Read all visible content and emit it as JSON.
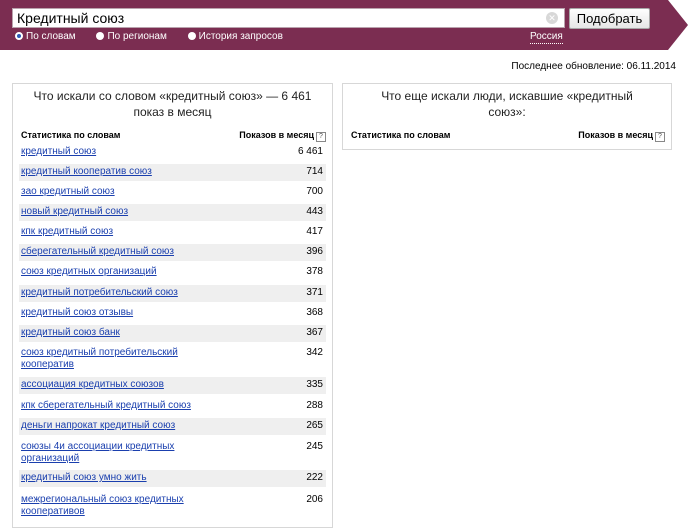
{
  "search": {
    "value": "Кредитный союз",
    "submit_label": "Подобрать"
  },
  "modes": [
    {
      "label": "По словам",
      "selected": true
    },
    {
      "label": "По регионам",
      "selected": false
    },
    {
      "label": "История запросов",
      "selected": false
    }
  ],
  "region": "Россия",
  "last_update": "Последнее обновление: 06.11.2014",
  "left_panel": {
    "title": "Что искали со словом «кредитный союз» — 6 461 показ в месяц",
    "col_words": "Статистика по словам",
    "col_count": "Показов в месяц",
    "rows": [
      {
        "phrase": "кредитный союз",
        "count": "6 461"
      },
      {
        "phrase": "кредитный кооператив союз",
        "count": "714"
      },
      {
        "phrase": "зао кредитный союз",
        "count": "700"
      },
      {
        "phrase": "новый кредитный союз",
        "count": "443"
      },
      {
        "phrase": "кпк кредитный союз",
        "count": "417"
      },
      {
        "phrase": "сберегательный кредитный союз",
        "count": "396"
      },
      {
        "phrase": "союз кредитных организаций",
        "count": "378"
      },
      {
        "phrase": "кредитный потребительский союз",
        "count": "371"
      },
      {
        "phrase": "кредитный союз отзывы",
        "count": "368"
      },
      {
        "phrase": "кредитный союз банк",
        "count": "367"
      },
      {
        "phrase": "союз кредитный потребительский кооператив",
        "count": "342"
      },
      {
        "phrase": "ассоциация кредитных союзов",
        "count": "335"
      },
      {
        "phrase": "кпк сберегательный кредитный союз",
        "count": "288"
      },
      {
        "phrase": "деньги напрокат кредитный союз",
        "count": "265"
      },
      {
        "phrase": "союзы 4и ассоциации кредитных организаций",
        "count": "245"
      },
      {
        "phrase": "кредитный союз умно жить",
        "count": "222"
      },
      {
        "phrase": "межрегиональный союз кредитных кооперативов",
        "count": "206"
      }
    ]
  },
  "right_panel": {
    "title": "Что еще искали люди, искавшие «кредитный союз»:",
    "col_words": "Статистика по словам",
    "col_count": "Показов в месяц"
  },
  "colors": {
    "header": "#7b2d51",
    "link": "#1a3fae",
    "row_alt": "#efefef"
  },
  "icons": [
    "clear-icon",
    "help-icon",
    "radio-icon"
  ]
}
